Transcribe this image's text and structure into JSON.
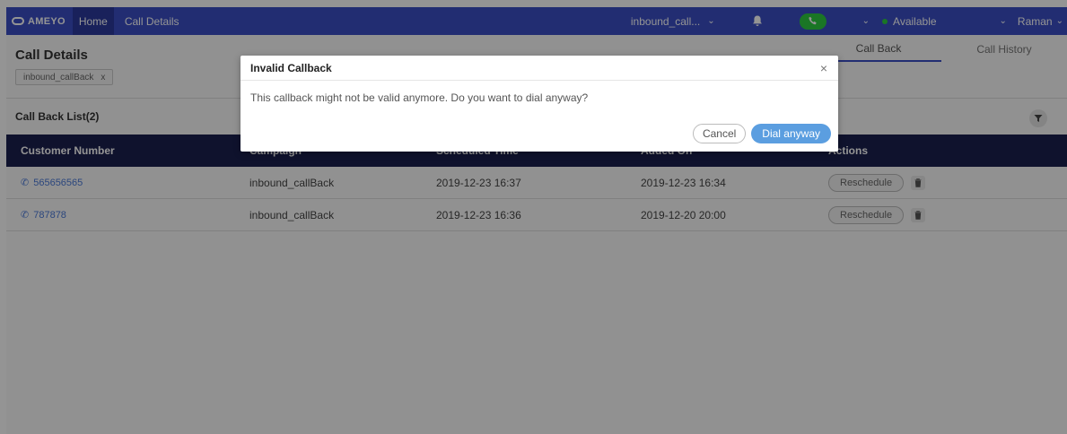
{
  "topbar": {
    "logo_text": "AMEYO",
    "home_label": "Home",
    "call_details_label": "Call Details",
    "campaign_selected": "inbound_call...",
    "status_label": "Available",
    "user_name": "Raman",
    "chevron": "⌄"
  },
  "page": {
    "title": "Call Details",
    "filter_chip": "inbound_callBack",
    "chip_close": "x",
    "tabs": [
      {
        "label": "Call Back",
        "active": true
      },
      {
        "label": "Call History",
        "active": false
      }
    ],
    "list_title": "Call Back List(2)"
  },
  "table": {
    "headers": [
      "Customer Number",
      "Campaign",
      "Scheduled Time",
      "Added On",
      "Actions"
    ],
    "rows": [
      {
        "number": "565656565",
        "campaign": "inbound_callBack",
        "scheduled": "2019-12-23 16:37",
        "added": "2019-12-23 16:34",
        "action": "Reschedule"
      },
      {
        "number": "787878",
        "campaign": "inbound_callBack",
        "scheduled": "2019-12-23 16:36",
        "added": "2019-12-20 20:00",
        "action": "Reschedule"
      }
    ]
  },
  "modal": {
    "title": "Invalid Callback",
    "close": "×",
    "message": "This callback might not be valid anymore. Do you want to dial anyway?",
    "cancel_label": "Cancel",
    "dial_label": "Dial anyway"
  },
  "colors": {
    "nav": "#3c4fc4",
    "table_header": "#1a1f4e",
    "available": "#2ecc40",
    "primary_button": "#5b9ee0",
    "link": "#4a79d8"
  },
  "icons": {
    "bell": "bell-icon",
    "phone": "phone-icon",
    "filter": "filter-icon",
    "trash": "trash-icon",
    "close": "close-icon"
  }
}
